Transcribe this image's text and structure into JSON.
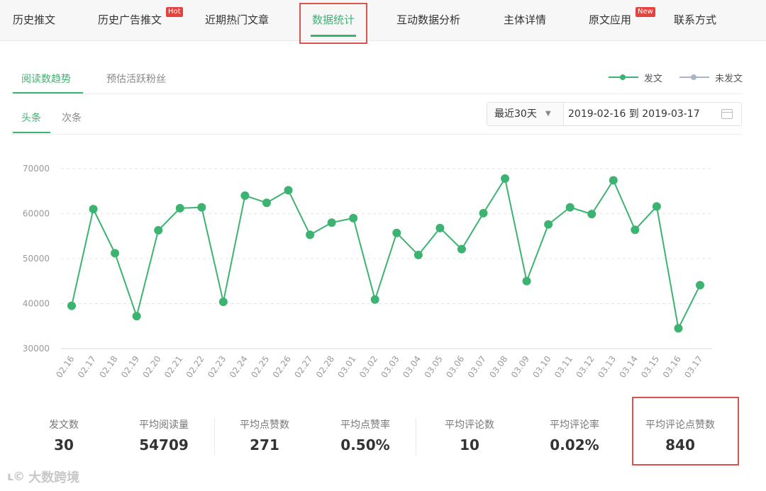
{
  "nav": {
    "items": [
      {
        "label": "历史推文"
      },
      {
        "label": "历史广告推文",
        "badge": "Hot"
      },
      {
        "label": "近期热门文章"
      },
      {
        "label": "数据统计",
        "active": true
      },
      {
        "label": "互动数据分析"
      },
      {
        "label": "主体详情"
      },
      {
        "label": "原文应用",
        "badge": "New"
      },
      {
        "label": "联系方式"
      }
    ]
  },
  "subtabs": {
    "primary": [
      {
        "label": "阅读数趋势",
        "active": true
      },
      {
        "label": "预估活跃粉丝"
      }
    ],
    "secondary": [
      {
        "label": "头条",
        "active": true
      },
      {
        "label": "次条"
      }
    ]
  },
  "legend": [
    {
      "label": "发文",
      "color": "#3cb371"
    },
    {
      "label": "未发文",
      "color": "#a9b6c6"
    }
  ],
  "range": {
    "select": "最近30天",
    "dates": "2019-02-16 到 2019-03-17"
  },
  "chart_data": {
    "type": "line",
    "categories": [
      "02.16",
      "02.17",
      "02.18",
      "02.19",
      "02.20",
      "02.21",
      "02.22",
      "02.23",
      "02.24",
      "02.25",
      "02.26",
      "02.27",
      "02.28",
      "03.01",
      "03.02",
      "03.03",
      "03.04",
      "03.05",
      "03.06",
      "03.07",
      "03.08",
      "03.09",
      "03.10",
      "03.11",
      "03.12",
      "03.13",
      "03.14",
      "03.15",
      "03.16",
      "03.17"
    ],
    "series": [
      {
        "name": "发文",
        "color": "#3cb371",
        "values": [
          39500,
          61000,
          51200,
          37200,
          56300,
          61200,
          61400,
          40400,
          64000,
          62400,
          65200,
          55300,
          58000,
          59000,
          40900,
          55700,
          50800,
          56800,
          52100,
          60100,
          67800,
          45000,
          57600,
          61400,
          59900,
          67400,
          56400,
          61600,
          34500,
          44100
        ]
      }
    ],
    "ylim": [
      30000,
      70000
    ],
    "yticks": [
      "30000",
      "40000",
      "50000",
      "60000",
      "70000"
    ],
    "grid": true,
    "legend_position": "top-right"
  },
  "stats": [
    {
      "label": "发文数",
      "value": "30"
    },
    {
      "label": "平均阅读量",
      "value": "54709"
    },
    {
      "label": "平均点赞数",
      "value": "271"
    },
    {
      "label": "平均点赞率",
      "value": "0.50%"
    },
    {
      "label": "平均评论数",
      "value": "10"
    },
    {
      "label": "平均评论率",
      "value": "0.02%"
    },
    {
      "label": "平均评论点赞数",
      "value": "840"
    }
  ],
  "watermark": {
    "logo": "ʟ©",
    "text": "大数跨境"
  }
}
